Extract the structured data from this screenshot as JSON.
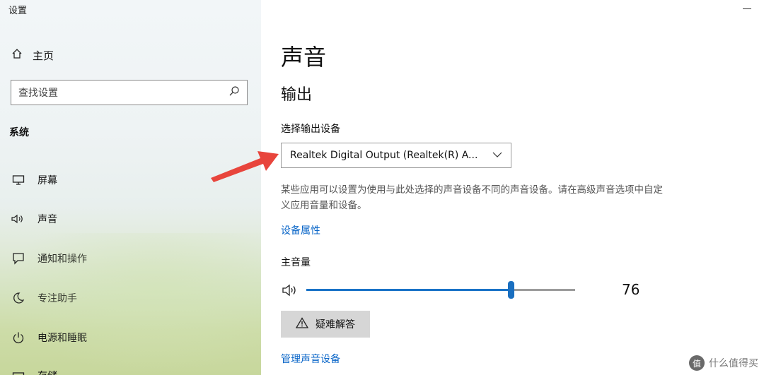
{
  "window": {
    "title": "设置"
  },
  "sidebar": {
    "home_label": "主页",
    "search_placeholder": "查找设置",
    "section_label": "系统",
    "items": [
      {
        "label": "屏幕",
        "icon": "monitor-icon"
      },
      {
        "label": "声音",
        "icon": "speaker-icon"
      },
      {
        "label": "通知和操作",
        "icon": "notification-icon"
      },
      {
        "label": "专注助手",
        "icon": "moon-icon"
      },
      {
        "label": "电源和睡眠",
        "icon": "power-icon"
      },
      {
        "label": "存储",
        "icon": "storage-icon"
      }
    ]
  },
  "main": {
    "page_title": "声音",
    "output_heading": "输出",
    "select_device_label": "选择输出设备",
    "selected_device": "Realtek Digital Output (Realtek(R) A...",
    "description": "某些应用可以设置为使用与此处选择的声音设备不同的声音设备。请在高级声音选项中自定义应用音量和设备。",
    "device_properties_link": "设备属性",
    "master_volume_label": "主音量",
    "volume_value": "76",
    "volume_level_percent": 76,
    "troubleshoot_button": "疑难解答",
    "manage_devices_link": "管理声音设备"
  },
  "colors": {
    "accent": "#1a73c7",
    "link": "#0a66c8",
    "arrow": "#e8453c"
  },
  "watermark": {
    "text": "什么值得买",
    "logo_char": "值"
  }
}
